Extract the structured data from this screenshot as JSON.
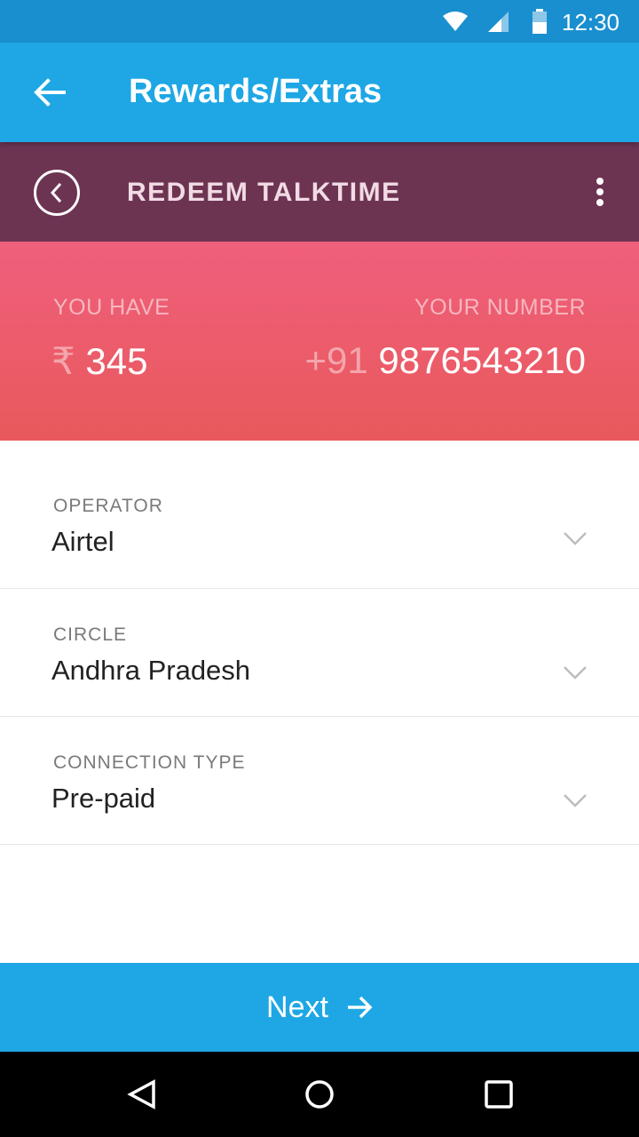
{
  "status_bar": {
    "time": "12:30",
    "icons": [
      "wifi-icon",
      "cellular-signal-icon",
      "battery-icon"
    ]
  },
  "app_bar": {
    "back_icon": "arrow-left-icon",
    "title": "Rewards/Extras"
  },
  "sub_bar": {
    "back_icon": "circle-chevron-left-icon",
    "title": "REDEEM TALKTIME",
    "more_icon": "more-vertical-icon"
  },
  "balance": {
    "you_have_label": "YOU HAVE",
    "currency_symbol": "₹",
    "amount": "345",
    "your_number_label": "YOUR NUMBER",
    "country_code": "+91",
    "phone_number": "9876543210"
  },
  "form": {
    "fields": [
      {
        "label": "OPERATOR",
        "value": "Airtel"
      },
      {
        "label": "CIRCLE",
        "value": "Andhra Pradesh"
      },
      {
        "label": "CONNECTION TYPE",
        "value": "Pre-paid"
      }
    ]
  },
  "next_button": {
    "label": "Next",
    "icon": "arrow-right-icon"
  },
  "nav_bar": {
    "icons": [
      "back-triangle-icon",
      "home-circle-icon",
      "recents-square-icon"
    ]
  },
  "colors": {
    "status_bar": "#1a8fd0",
    "app_bar": "#1ea7e4",
    "sub_bar": "#6d3452",
    "balance_top": "#f05f7c",
    "balance_bottom": "#e8595c",
    "next_button": "#1ea7e4"
  }
}
